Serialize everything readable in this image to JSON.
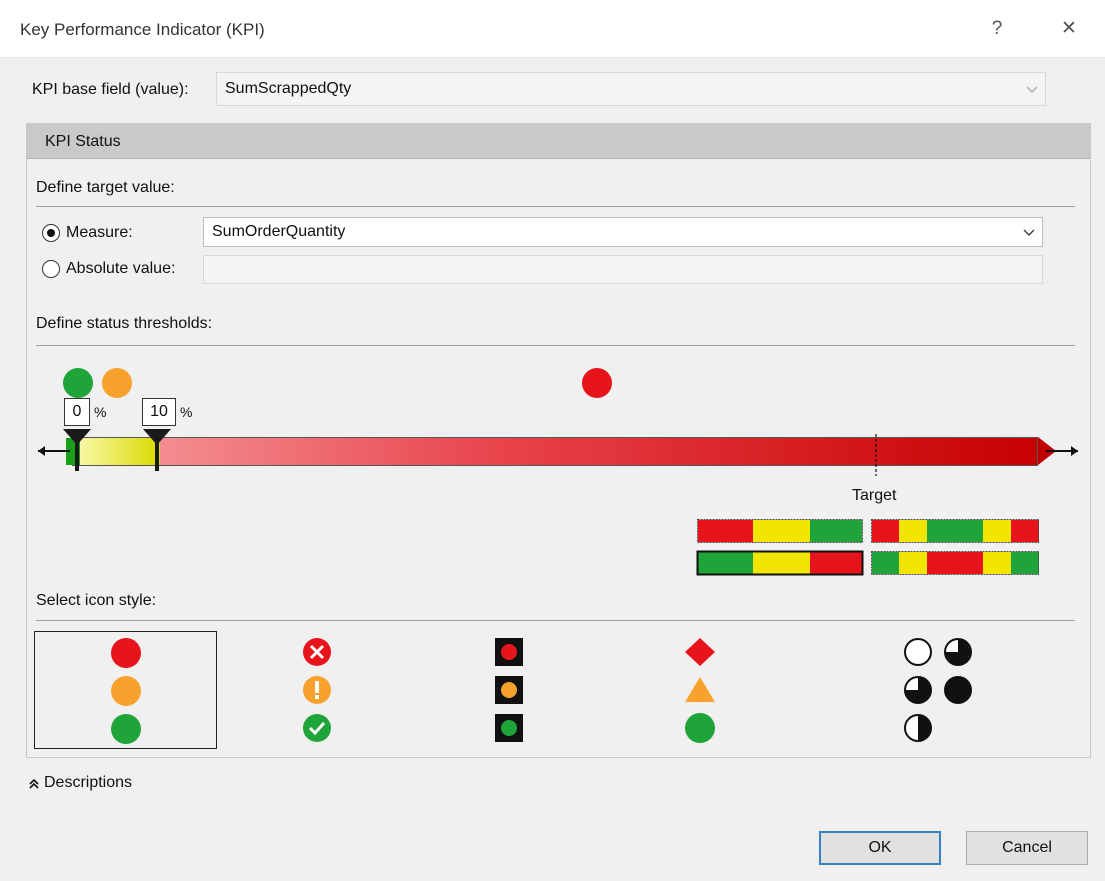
{
  "window": {
    "title": "Key Performance Indicator (KPI)",
    "help_glyph": "?",
    "close_glyph": "✕"
  },
  "base_field": {
    "label": "KPI base field (value):",
    "value": "SumScrappedQty"
  },
  "kpi_status": {
    "header": "KPI Status",
    "target": {
      "title": "Define target value:",
      "measure_label": "Measure:",
      "measure_value": "SumOrderQuantity",
      "absolute_label": "Absolute value:",
      "absolute_value": "",
      "selected": "measure"
    },
    "thresholds": {
      "title": "Define status thresholds:",
      "low_value": "0",
      "high_value": "10",
      "unit": "%",
      "target_label": "Target",
      "colors": {
        "green": "#1fa43a",
        "amber": "#f7a22c",
        "red": "#e8141c",
        "yellow": "#f2e600"
      }
    },
    "icon_style": {
      "title": "Select icon style:",
      "selected_index": 0,
      "styles": [
        "circles",
        "symbols",
        "traffic-lights",
        "shapes",
        "pie-quarters"
      ]
    }
  },
  "descriptions": {
    "label": "Descriptions",
    "expander_glyph": "«"
  },
  "buttons": {
    "ok": "OK",
    "cancel": "Cancel"
  }
}
